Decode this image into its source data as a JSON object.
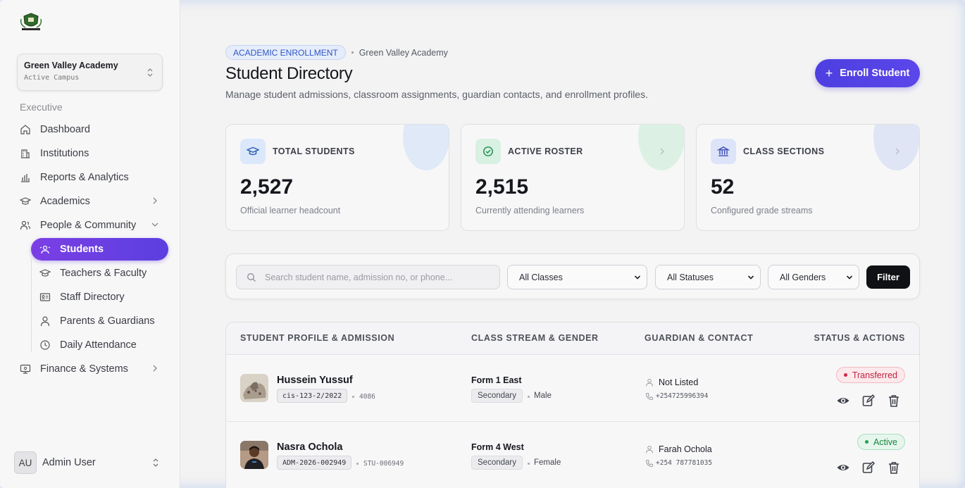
{
  "sidebar": {
    "campus": {
      "name": "Green Valley Academy",
      "subtitle": "Active Campus"
    },
    "section_label": "Executive",
    "items": [
      {
        "label": "Dashboard",
        "icon": "home-icon"
      },
      {
        "label": "Institutions",
        "icon": "building-icon"
      },
      {
        "label": "Reports & Analytics",
        "icon": "bar-chart-icon"
      },
      {
        "label": "Academics",
        "icon": "graduation-cap-icon",
        "expandable": true
      },
      {
        "label": "People & Community",
        "icon": "users-icon",
        "expanded": true
      },
      {
        "label": "Finance & Systems",
        "icon": "monitor-icon",
        "expandable": true
      }
    ],
    "sub_items": [
      {
        "label": "Students",
        "icon": "students-icon",
        "active": true
      },
      {
        "label": "Teachers & Faculty",
        "icon": "graduation-cap-icon"
      },
      {
        "label": "Staff Directory",
        "icon": "id-card-icon"
      },
      {
        "label": "Parents & Guardians",
        "icon": "user-icon"
      },
      {
        "label": "Daily Attendance",
        "icon": "clock-icon"
      }
    ],
    "user": {
      "initials": "AU",
      "name": "Admin User"
    }
  },
  "header": {
    "breadcrumb_pill": "ACADEMIC ENROLLMENT",
    "breadcrumb_text": "Green Valley Academy",
    "title": "Student Directory",
    "description": "Manage student admissions, classroom assignments, guardian contacts, and enrollment profiles.",
    "enroll_label": "Enroll Student"
  },
  "stats": [
    {
      "label": "TOTAL STUDENTS",
      "value": "2,527",
      "caption": "Official learner headcount",
      "icon": "graduation-cap-icon",
      "color": "#d9e6fb"
    },
    {
      "label": "ACTIVE ROSTER",
      "value": "2,515",
      "caption": "Currently attending learners",
      "icon": "check-badge-icon",
      "color": "#d8f1e2"
    },
    {
      "label": "CLASS SECTIONS",
      "value": "52",
      "caption": "Configured grade streams",
      "icon": "bank-icon",
      "color": "#dde3f8"
    }
  ],
  "filters": {
    "search_placeholder": "Search student name, admission no, or phone...",
    "class_selected": "All Classes",
    "status_selected": "All Statuses",
    "gender_selected": "All Genders",
    "filter_label": "Filter"
  },
  "table": {
    "headers": [
      "STUDENT PROFILE & ADMISSION",
      "CLASS STREAM & GENDER",
      "GUARDIAN & CONTACT",
      "STATUS & ACTIONS"
    ],
    "rows": [
      {
        "name": "Hussein Yussuf",
        "admission": "cis-123-2/2022",
        "code": "4086",
        "class": "Form 1 East",
        "level": "Secondary",
        "gender": "Male",
        "guardian": "Not Listed",
        "phone": "+254725996394",
        "status": "Transferred"
      },
      {
        "name": "Nasra Ochola",
        "admission": "ADM-2026-002949",
        "code": "STU-006949",
        "class": "Form 4 West",
        "level": "Secondary",
        "gender": "Female",
        "guardian": "Farah Ochola",
        "phone": "+254 787781035",
        "status": "Active"
      }
    ]
  },
  "colors": {
    "accent": "#5b3fe0",
    "transferred": "#c0223f",
    "active": "#17853f"
  }
}
